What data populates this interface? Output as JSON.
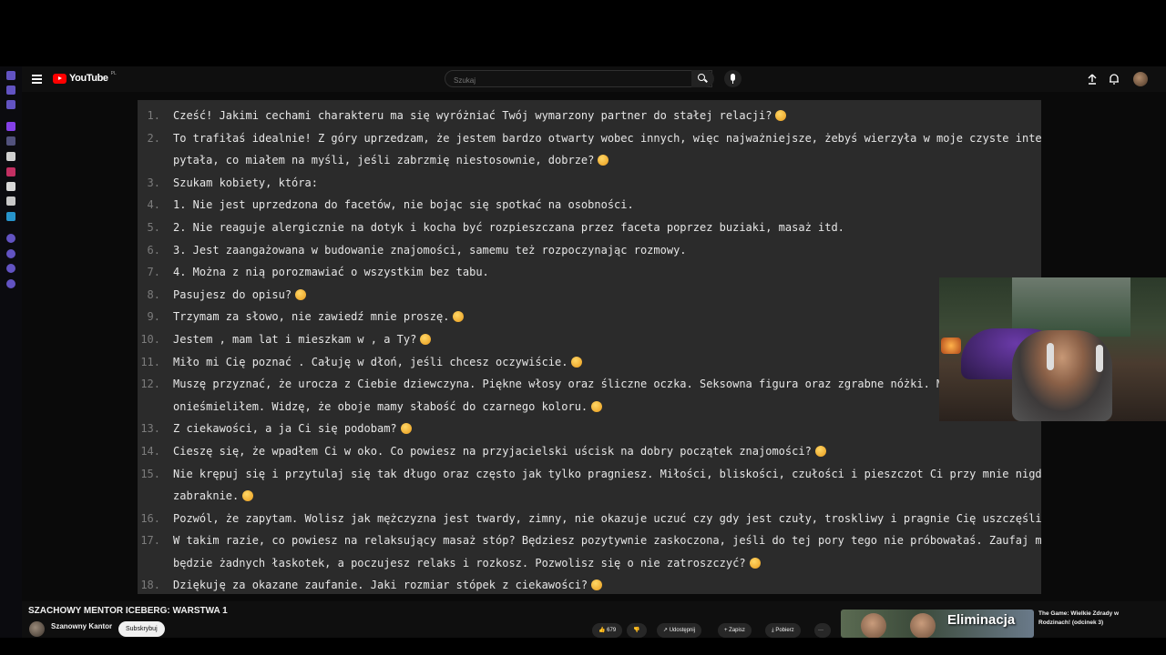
{
  "app": {
    "logo_text": "YouTube",
    "logo_sup": "PL"
  },
  "search": {
    "placeholder": "Szukaj"
  },
  "chat": {
    "lines": [
      {
        "n": "1.",
        "t": "Cześć! Jakimi cechami charakteru ma się wyróżniać Twój wymarzony partner do stałej relacji?",
        "emoji": true
      },
      {
        "n": "2.",
        "t": "To trafiłaś idealnie! Z góry uprzedzam, że jestem bardzo otwarty wobec innych, więc najważniejsze, żebyś wierzyła w moje czyste intencje i",
        "t2": "pytała, co miałem na myśli, jeśli zabrzmię niestosownie, dobrze?",
        "emoji": true
      },
      {
        "n": "3.",
        "t": "Szukam kobiety, która:"
      },
      {
        "n": "4.",
        "t": "1. Nie jest uprzedzona do facetów, nie bojąc się spotkać na osobności."
      },
      {
        "n": "5.",
        "t": "2. Nie reaguje alergicznie na dotyk i kocha być rozpieszczana przez faceta poprzez buziaki, masaż itd."
      },
      {
        "n": "6.",
        "t": "3. Jest zaangażowana w budowanie znajomości, samemu też rozpoczynając rozmowy."
      },
      {
        "n": "7.",
        "t": "4. Można z nią porozmawiać o wszystkim bez tabu."
      },
      {
        "n": "8.",
        "t": "Pasujesz do opisu?",
        "emoji": true
      },
      {
        "n": "9.",
        "t": "Trzymam za słowo, nie zawiedź mnie proszę.",
        "emoji": true
      },
      {
        "n": "10.",
        "t": "Jestem , mam  lat i mieszkam w , a Ty?",
        "emoji": true
      },
      {
        "n": "11.",
        "t": "Miło mi Cię poznać . Całuję w dłoń, jeśli chcesz oczywiście.",
        "emoji": true
      },
      {
        "n": "12.",
        "t": "Muszę przyznać, że urocza z Ciebie dziewczyna. Piękne włosy oraz śliczne oczka. Seksowna figura oraz zgrabne nóżki. Mam nadz",
        "t2": "onieśmieliłem. Widzę, że oboje mamy słabość do czarnego koloru.",
        "emoji": true
      },
      {
        "n": "13.",
        "t": "Z ciekawości, a ja Ci się podobam?",
        "emoji": true
      },
      {
        "n": "14.",
        "t": "Cieszę się, że wpadłem Ci w oko. Co powiesz na przyjacielski uścisk na dobry początek znajomości?",
        "emoji": true
      },
      {
        "n": "15.",
        "t": "Nie krępuj się i przytulaj się tak długo oraz często jak tylko pragniesz. Miłości, bliskości, czułości i pieszczot Ci przy mnie nigdy nie",
        "t2": "zabraknie.",
        "emoji": true
      },
      {
        "n": "16.",
        "t": "Pozwól, że zapytam. Wolisz jak mężczyzna jest twardy, zimny, nie okazuje uczuć czy gdy jest czuły, troskliwy i pragnie Cię uszczęśliwić?",
        "emoji": true
      },
      {
        "n": "17.",
        "t": "W takim razie, co powiesz na relaksujący masaż stóp? Będziesz pozytywnie zaskoczona, jeśli do tej pory tego nie próbowałaś. Zaufaj mi, a nie",
        "t2": "będzie żadnych łaskotek, a poczujesz relaks i rozkosz. Pozwolisz się o nie zatroszczyć?",
        "emoji": true
      },
      {
        "n": "18.",
        "t": "Dziękuję za okazane zaufanie. Jaki rozmiar stópek z ciekawości?",
        "emoji": true
      }
    ]
  },
  "video": {
    "title": "SZACHOWY MENTOR ICEBERG: WARSTWA 1",
    "channel": "Szanowny Kantor",
    "subscribe": "Subskrybuj",
    "likes": "679",
    "share": "Udostępnij",
    "save": "Zapisz",
    "download": "Pobierz",
    "more": "···"
  },
  "recommended": {
    "thumb_text": "Eliminacja",
    "title": "The Game: Wielkie Zdrady w Rodzinach! (odcinek 3)"
  },
  "colors": {
    "brand": "#ff0000",
    "panel": "#2b2b2b",
    "line_numbers": "#7c7c7c"
  }
}
